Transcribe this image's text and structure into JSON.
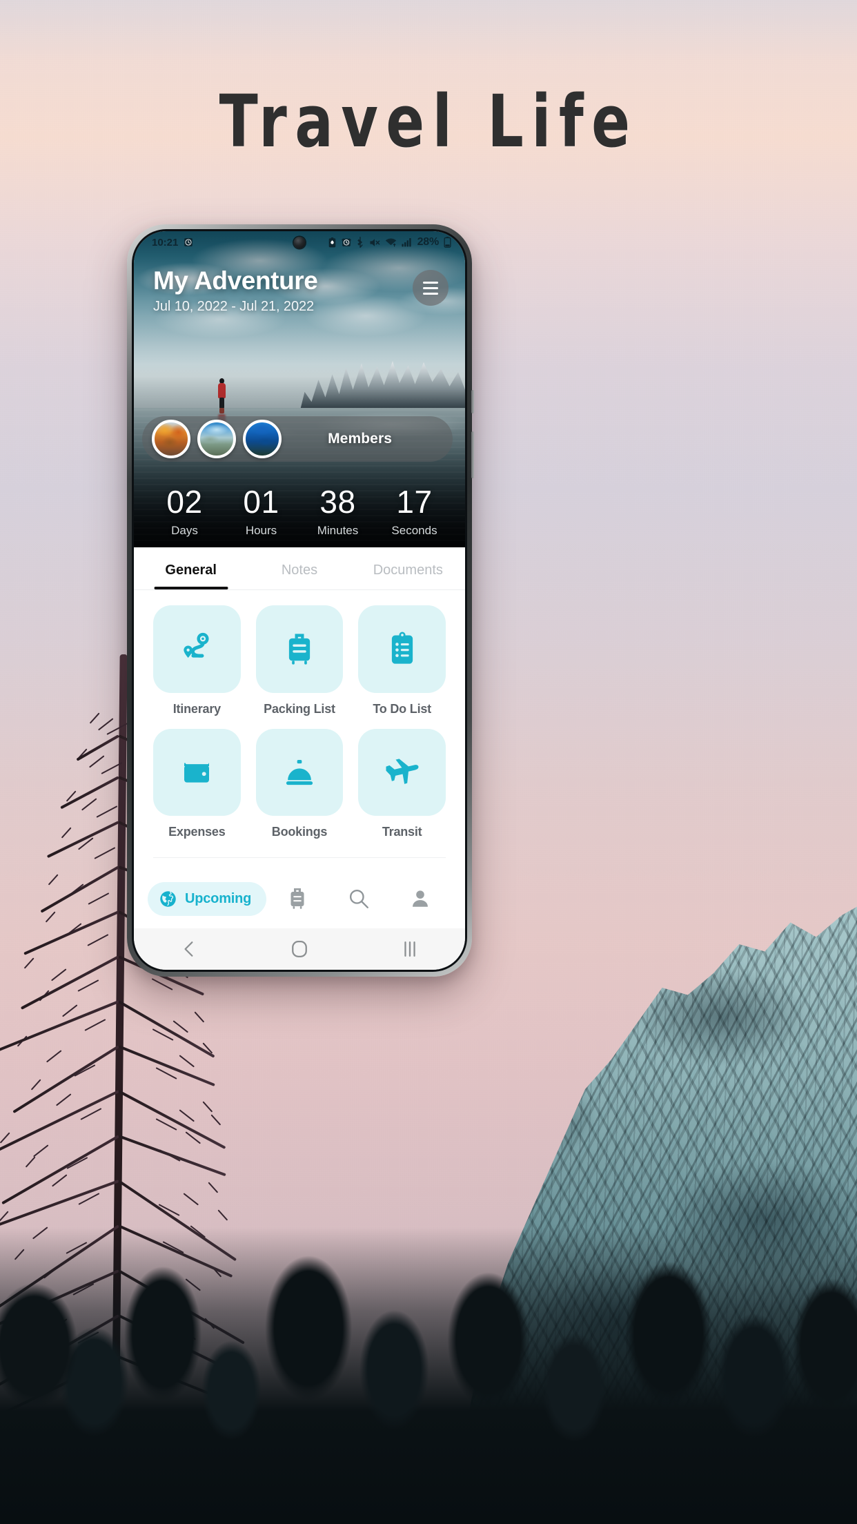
{
  "page": {
    "title": "Travel Life"
  },
  "phone": {
    "statusbar": {
      "time": "10:21",
      "battery_percent": "28%",
      "icons": [
        "alarm-clock-icon",
        "battery-saver-icon",
        "alarm-icon",
        "bluetooth-icon",
        "mute-icon",
        "wifi-icon",
        "cellular-signal-icon",
        "battery-icon"
      ]
    },
    "hero": {
      "trip_title": "My Adventure",
      "trip_dates": "Jul 10, 2022 - Jul 21, 2022",
      "menu_label": "hamburger-menu-icon",
      "members_label": "Members",
      "members_count": 3,
      "countdown": [
        {
          "value": "02",
          "label": "Days"
        },
        {
          "value": "01",
          "label": "Hours"
        },
        {
          "value": "38",
          "label": "Minutes"
        },
        {
          "value": "17",
          "label": "Seconds"
        }
      ]
    },
    "tabs": [
      {
        "label": "General",
        "active": true
      },
      {
        "label": "Notes",
        "active": false
      },
      {
        "label": "Documents",
        "active": false
      }
    ],
    "grid": [
      {
        "label": "Itinerary",
        "icon": "route-icon"
      },
      {
        "label": "Packing List",
        "icon": "suitcase-icon"
      },
      {
        "label": "To Do List",
        "icon": "clipboard-list-icon"
      },
      {
        "label": "Expenses",
        "icon": "wallet-icon"
      },
      {
        "label": "Bookings",
        "icon": "service-bell-icon"
      },
      {
        "label": "Transit",
        "icon": "airplane-icon"
      }
    ],
    "bottom_nav": [
      {
        "label": "Upcoming",
        "icon": "globe-icon",
        "active": true
      },
      {
        "label": "",
        "icon": "luggage-icon",
        "active": false
      },
      {
        "label": "",
        "icon": "search-icon",
        "active": false
      },
      {
        "label": "",
        "icon": "profile-icon",
        "active": false
      }
    ],
    "android_nav": [
      {
        "icon": "back-icon"
      },
      {
        "icon": "home-icon"
      },
      {
        "icon": "recents-icon"
      }
    ]
  },
  "colors": {
    "accent": "#17b2cd",
    "tile_bg": "#ddf4f6",
    "pill_bg": "#e2f6f9",
    "title_text": "#2f2f2f"
  }
}
